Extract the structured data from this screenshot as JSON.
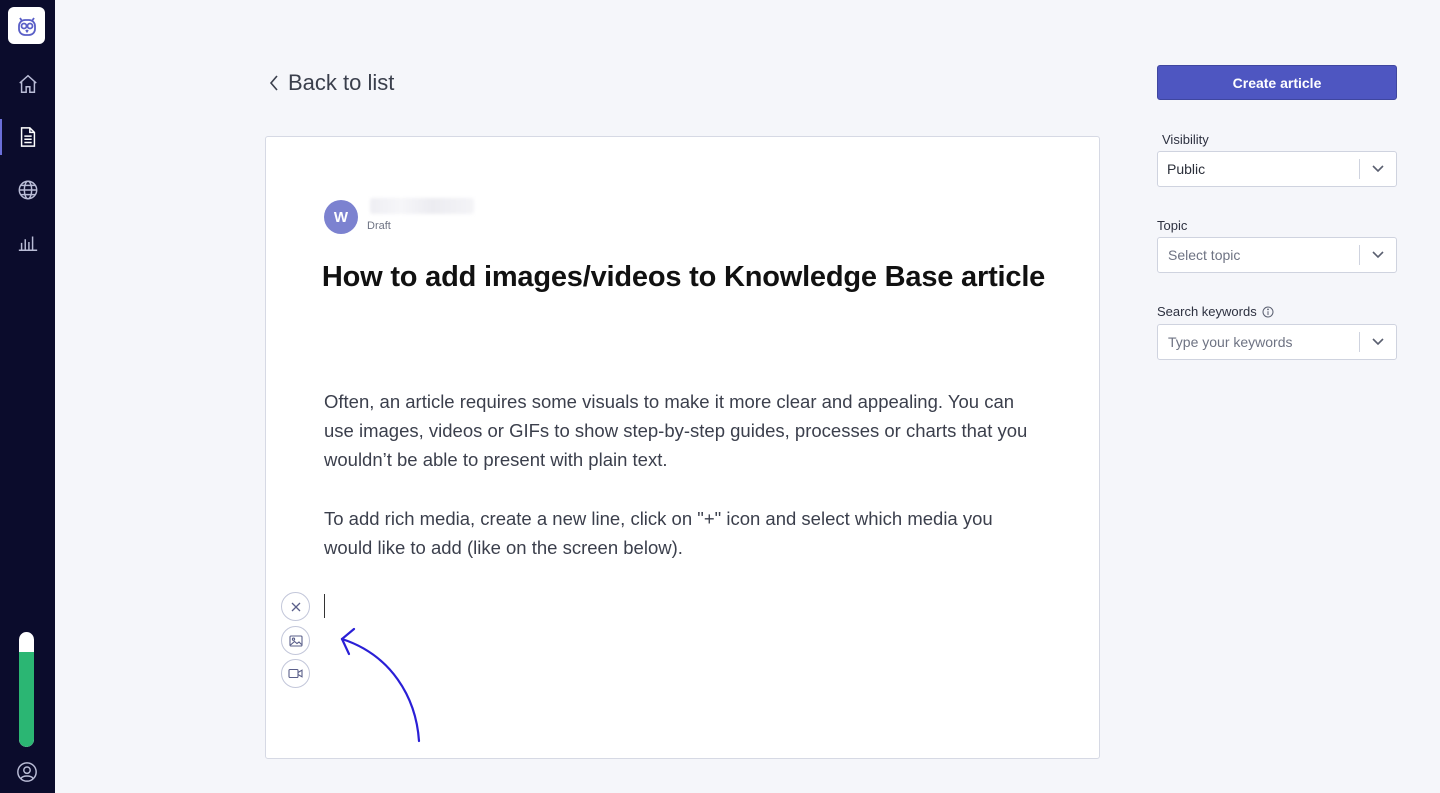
{
  "sidebar": {
    "nav_items": [
      {
        "icon": "home-icon"
      },
      {
        "icon": "document-icon",
        "active": true
      },
      {
        "icon": "globe-icon"
      },
      {
        "icon": "bar-chart-icon"
      }
    ],
    "level_fill": 0.83,
    "level_color": "#2bb673"
  },
  "header": {
    "back_label": "Back to list"
  },
  "article": {
    "author_initial": "W",
    "status": "Draft",
    "title": "How to add images/videos to Knowledge Base article",
    "paragraphs": [
      "Often, an article requires some visuals to make it more clear and appealing. You can use images, videos or GIFs to show step-by-step guides, processes or charts that you wouldn’t be able to present with plain text.",
      "To add rich media, create a new line, click on \"+\" icon and select which media you would like to add (like on the screen below)."
    ]
  },
  "panel": {
    "create_label": "Create article",
    "visibility": {
      "label": "Visibility",
      "value": "Public"
    },
    "topic": {
      "label": "Topic",
      "placeholder": "Select topic"
    },
    "keywords": {
      "label": "Search keywords",
      "placeholder": "Type your keywords"
    }
  },
  "colors": {
    "sidebar": "#0b0c2c",
    "accent": "#4e56c1",
    "arrow": "#2a1fd6"
  }
}
